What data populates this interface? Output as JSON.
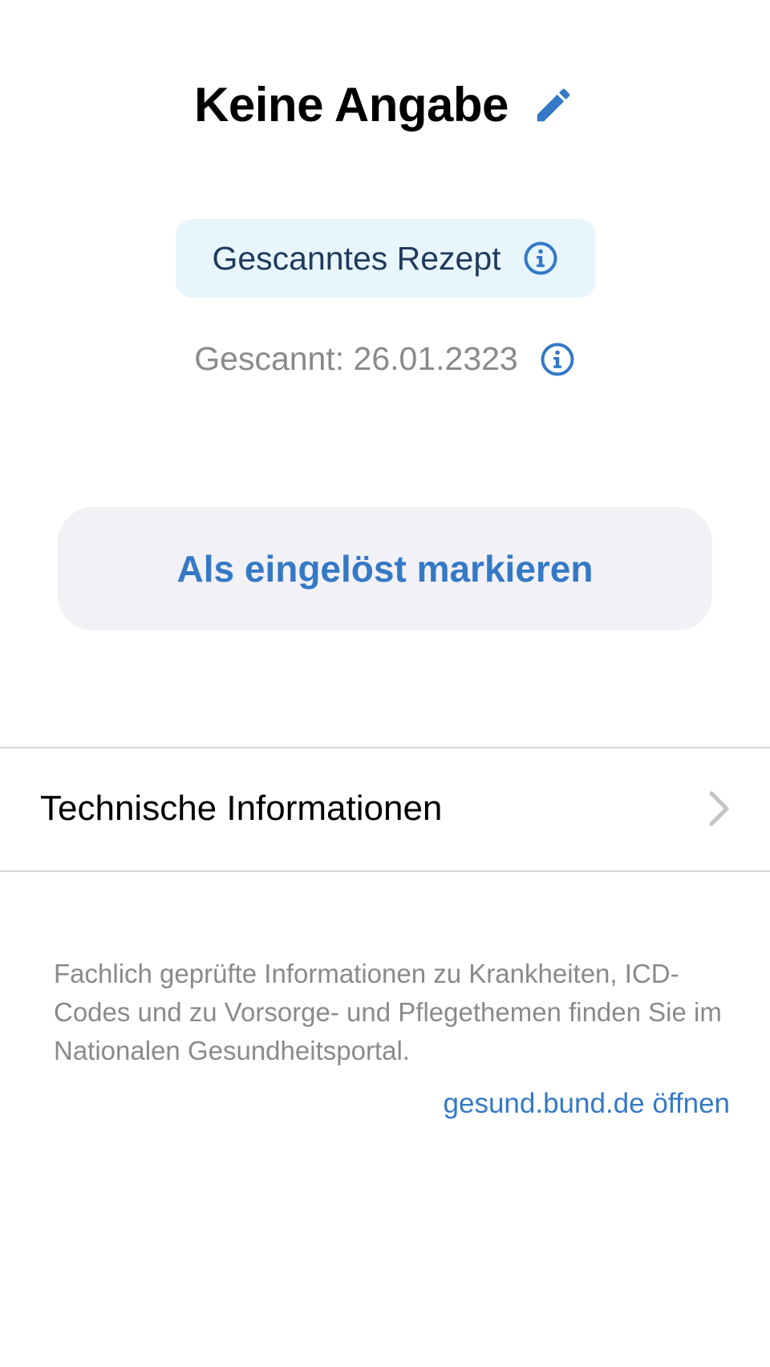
{
  "header": {
    "title": "Keine Angabe",
    "edit_icon": "pencil-icon"
  },
  "badge": {
    "label": "Gescanntes Rezept",
    "icon": "info-icon"
  },
  "scanned": {
    "text": "Gescannt: 26.01.2323",
    "icon": "info-icon"
  },
  "action": {
    "label": "Als eingelöst markieren"
  },
  "technical_row": {
    "label": "Technische Informationen",
    "icon": "chevron-right-icon"
  },
  "footer": {
    "text": "Fachlich geprüfte Informationen zu Krankheiten, ICD-Codes und zu Vorsorge- und Pflegethemen finden Sie im Nationalen Gesundheitsportal.",
    "link_label": "gesund.bund.de öffnen"
  },
  "colors": {
    "accent": "#3579c6",
    "badge_background": "#e8f5fd",
    "button_background": "#f1f1f6",
    "secondary_text": "#8a8a8e",
    "divider": "#d8d8dc"
  }
}
